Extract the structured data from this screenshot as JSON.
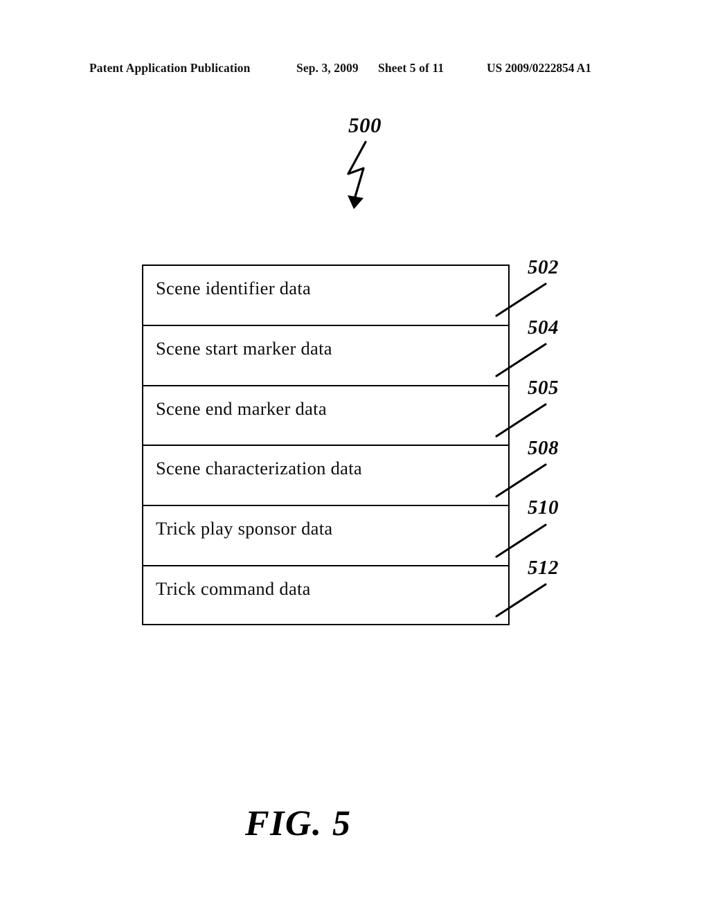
{
  "header": {
    "publication": "Patent Application Publication",
    "date": "Sep. 3, 2009",
    "sheet": "Sheet 5 of 11",
    "patent_number": "US 2009/0222854 A1"
  },
  "figure": {
    "caption": "FIG. 5",
    "overall_reference": "500",
    "structure": {
      "rows": [
        {
          "label": "Scene identifier data",
          "ref": "502"
        },
        {
          "label": "Scene start marker data",
          "ref": "504"
        },
        {
          "label": "Scene end marker data",
          "ref": "505"
        },
        {
          "label": "Scene characterization data",
          "ref": "508"
        },
        {
          "label": "Trick play sponsor data",
          "ref": "510"
        },
        {
          "label": "Trick command data",
          "ref": "512"
        }
      ]
    }
  },
  "colors": {
    "ink": "#000000",
    "paper": "#ffffff"
  }
}
